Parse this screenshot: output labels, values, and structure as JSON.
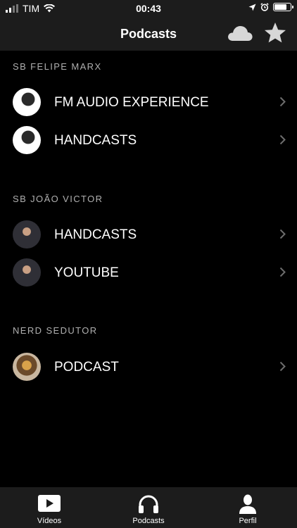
{
  "status": {
    "carrier": "TIM",
    "time": "00:43"
  },
  "nav": {
    "title": "Podcasts",
    "cloud_icon": "cloud-icon",
    "star_icon": "star-icon"
  },
  "sections": [
    {
      "header": "SB FELIPE MARX",
      "items": [
        {
          "label": "FM AUDIO EXPERIENCE"
        },
        {
          "label": "HANDCASTS"
        }
      ]
    },
    {
      "header": "SB JOÃO VICTOR",
      "items": [
        {
          "label": "HANDCASTS"
        },
        {
          "label": "YOUTUBE"
        }
      ]
    },
    {
      "header": "NERD SEDUTOR",
      "items": [
        {
          "label": "PODCAST"
        }
      ]
    }
  ],
  "tabbar": {
    "tabs": [
      {
        "label": "Vídeos",
        "icon": "play-icon"
      },
      {
        "label": "Podcasts",
        "icon": "headphones-icon"
      },
      {
        "label": "Perfil",
        "icon": "person-icon"
      }
    ]
  }
}
